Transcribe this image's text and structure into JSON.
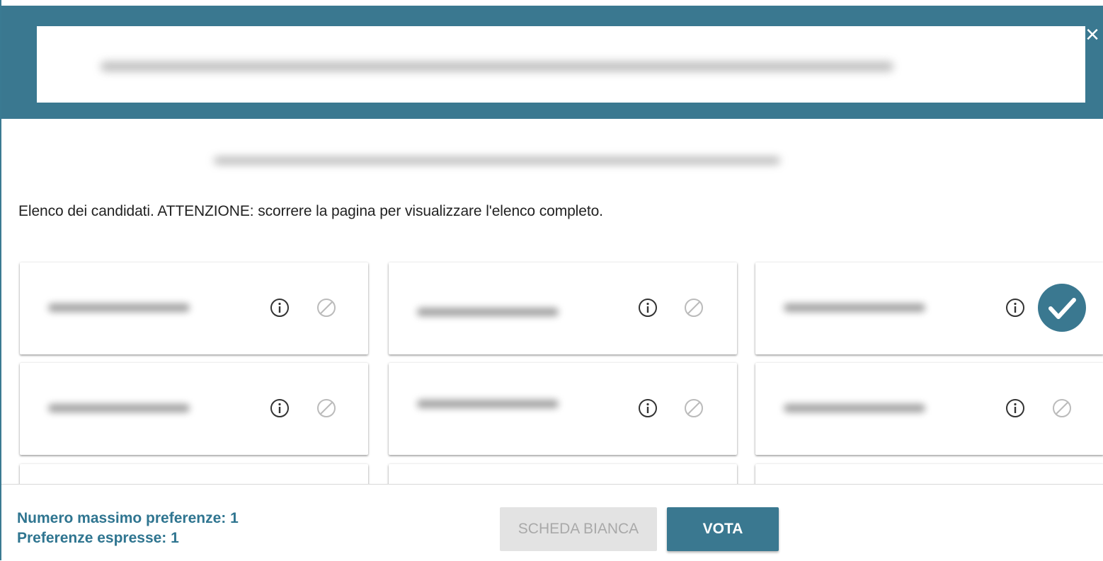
{
  "header": {
    "close_icon": "close-icon"
  },
  "instructions": "Elenco dei candidati. ATTENZIONE: scorrere la pagina per visualizzare l'elenco completo.",
  "candidates": [
    {
      "selected": false
    },
    {
      "selected": false
    },
    {
      "selected": true
    },
    {
      "selected": false
    },
    {
      "selected": false
    },
    {
      "selected": false
    }
  ],
  "footer": {
    "max_preferences": "Numero massimo preferenze: 1",
    "expressed_preferences": "Preferenze espresse: 1",
    "blank_ballot_label": "SCHEDA BIANCA",
    "vote_label": "VOTA"
  },
  "colors": {
    "accent": "#3a7890",
    "stats_text": "#2f7590",
    "disabled_button": "#e3e3e3"
  }
}
